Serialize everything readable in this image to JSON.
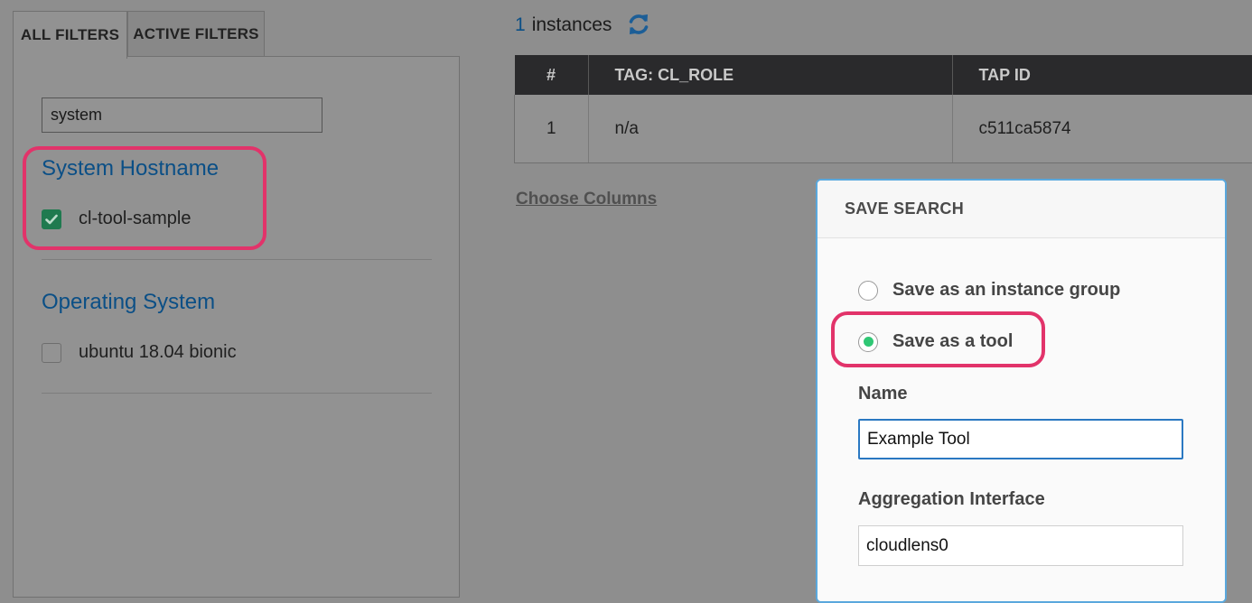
{
  "filters": {
    "tabs": [
      {
        "label": "ALL FILTERS",
        "active": true
      },
      {
        "label": "ACTIVE FILTERS",
        "active": false
      }
    ],
    "search_value": "system",
    "groups": [
      {
        "title": "System Hostname",
        "options": [
          {
            "label": "cl-tool-sample",
            "checked": true
          }
        ]
      },
      {
        "title": "Operating System",
        "options": [
          {
            "label": "ubuntu 18.04 bionic",
            "checked": false
          }
        ]
      }
    ]
  },
  "results": {
    "count": "1",
    "count_label": "instances",
    "refresh_icon": "refresh-icon",
    "columns": [
      "#",
      "TAG: CL_ROLE",
      "TAP ID"
    ],
    "rows": [
      [
        "1",
        "n/a",
        "c511ca5874"
      ]
    ],
    "choose_columns_label": "Choose Columns"
  },
  "save_search": {
    "title": "SAVE SEARCH",
    "options": [
      {
        "label": "Save as an instance group",
        "selected": false
      },
      {
        "label": "Save as a tool",
        "selected": true
      }
    ],
    "name_label": "Name",
    "name_value": "Example Tool",
    "aggregation_label": "Aggregation Interface",
    "aggregation_value": "cloudlens0"
  },
  "colors": {
    "overlay": "#8e8e8e",
    "link_blue": "#0b4f86",
    "highlight": "#e2336a",
    "checkbox_green": "#1f7a4f",
    "radio_green": "#2fc774",
    "modal_border": "#5aa8dd",
    "table_header": "#2a2a2c"
  }
}
